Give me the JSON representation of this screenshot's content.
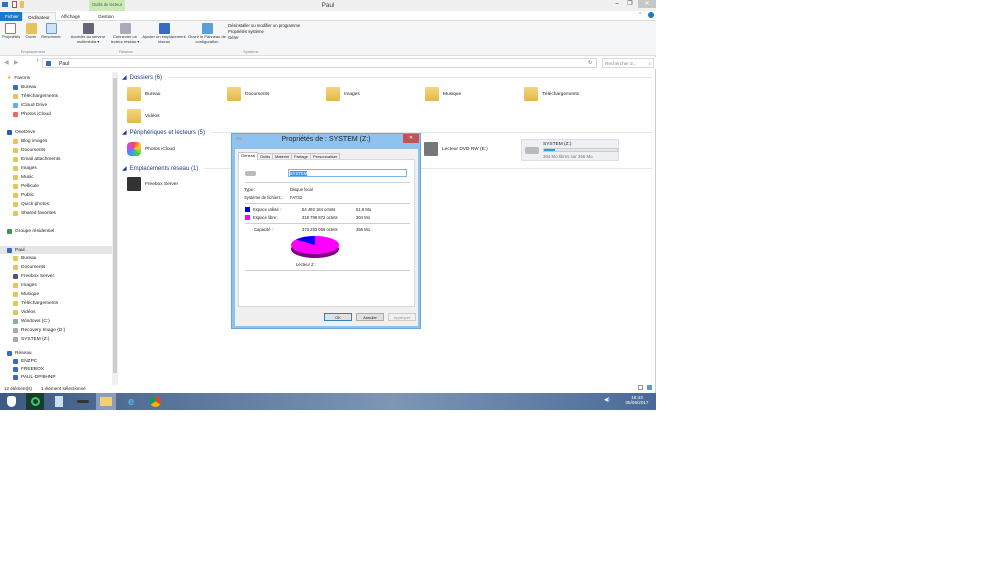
{
  "window": {
    "title": "Paul",
    "minimize": "–",
    "maximize": "❐",
    "close": "✕"
  },
  "ribbon": {
    "context_label": "Outils de lecteur",
    "tabs": [
      "Fichier",
      "Ordinateur",
      "Affichage",
      "Gestion"
    ],
    "buttons": [
      {
        "label": "Propriétés",
        "icon": "properties-icon"
      },
      {
        "label": "Ouvrir",
        "icon": "open-icon"
      },
      {
        "label": "Renommer",
        "icon": "rename-icon"
      },
      {
        "label": "Accéder au serveur multimédia ▾",
        "icon": "media-server-icon"
      },
      {
        "label": "Connecter un lecteur réseau ▾",
        "icon": "map-drive-icon"
      },
      {
        "label": "Ajouter un emplacement réseau",
        "icon": "add-network-location-icon"
      },
      {
        "label": "Ouvrir le Panneau de configuration",
        "icon": "control-panel-icon"
      }
    ],
    "small_buttons": [
      "Désinstaller ou modifier un programme",
      "Propriétés système",
      "Gérer"
    ],
    "groups": [
      "Emplacement",
      "Réseau",
      "Système"
    ]
  },
  "address": {
    "path": "Paul",
    "search_placeholder": "Rechercher d...",
    "accent": "#1979ca"
  },
  "nav": {
    "favorites": {
      "label": "Favoris",
      "items": [
        "Bureau",
        "Téléchargements",
        "iCloud Drive",
        "Photos iCloud"
      ]
    },
    "onedrive": {
      "label": "OneDrive",
      "items": [
        "Blog images",
        "Documents",
        "Email attachments",
        "Images",
        "Music",
        "Pellicule",
        "Public",
        "Quick photos",
        "Shared favorites"
      ]
    },
    "homegroup": "Groupe résidentiel",
    "pc": {
      "label": "Paul",
      "items": [
        "Bureau",
        "Documents",
        "Freebox Server",
        "Images",
        "Musique",
        "Téléchargements",
        "Vidéos",
        "Windows (C:)",
        "Recovery Image (D:)",
        "SYSTEM (Z:)"
      ]
    },
    "network": {
      "label": "Réseau",
      "items": [
        "ENZPC",
        "FREEBOX",
        "PAUL-DPI9HNP"
      ]
    }
  },
  "content": {
    "folders_header": "Dossiers (6)",
    "folders": [
      "Bureau",
      "Documents",
      "Images",
      "Musique",
      "Téléchargements",
      "Vidéos"
    ],
    "devices_header": "Périphériques et lecteurs (5)",
    "devices": [
      "Photos iCloud",
      "Lecteur DVD RW (E:)"
    ],
    "system_drive": {
      "name": "SYSTEM (Z:)",
      "free_text": "304 Mo libres sur 356 Mo",
      "used_fraction": 0.146
    },
    "network_header": "Emplacements réseau (1)",
    "network": [
      "Freebox Server"
    ]
  },
  "status": {
    "count": "12 élément(s)",
    "selected": "1 élément sélectionné"
  },
  "taskbar": {
    "time": "16:43",
    "date": "05/06/2017"
  },
  "dialog": {
    "title": "Propriétés de : SYSTEM (Z:)",
    "tabs": [
      "Général",
      "Outils",
      "Matériel",
      "Partage",
      "Personnaliser"
    ],
    "name_value": "SYSTEM",
    "type_label": "Type :",
    "type_value": "Disque local",
    "fs_label": "Système de fichiers :",
    "fs_value": "FAT32",
    "used_label": "Espace utilisé :",
    "used_bytes": "54 493 184 octets",
    "used_size": "51,9 Mo",
    "used_color": "#0000ff",
    "free_label": "Espace libre :",
    "free_bytes": "318 799 872 octets",
    "free_size": "304 Mo",
    "free_color": "#ff00ff",
    "capacity_label": "Capacité :",
    "capacity_bytes": "373 293 056 octets",
    "capacity_size": "356 Mo",
    "drive_label": "Lecteur Z :",
    "ok": "OK",
    "cancel": "Annuler",
    "apply": "Appliquer"
  }
}
